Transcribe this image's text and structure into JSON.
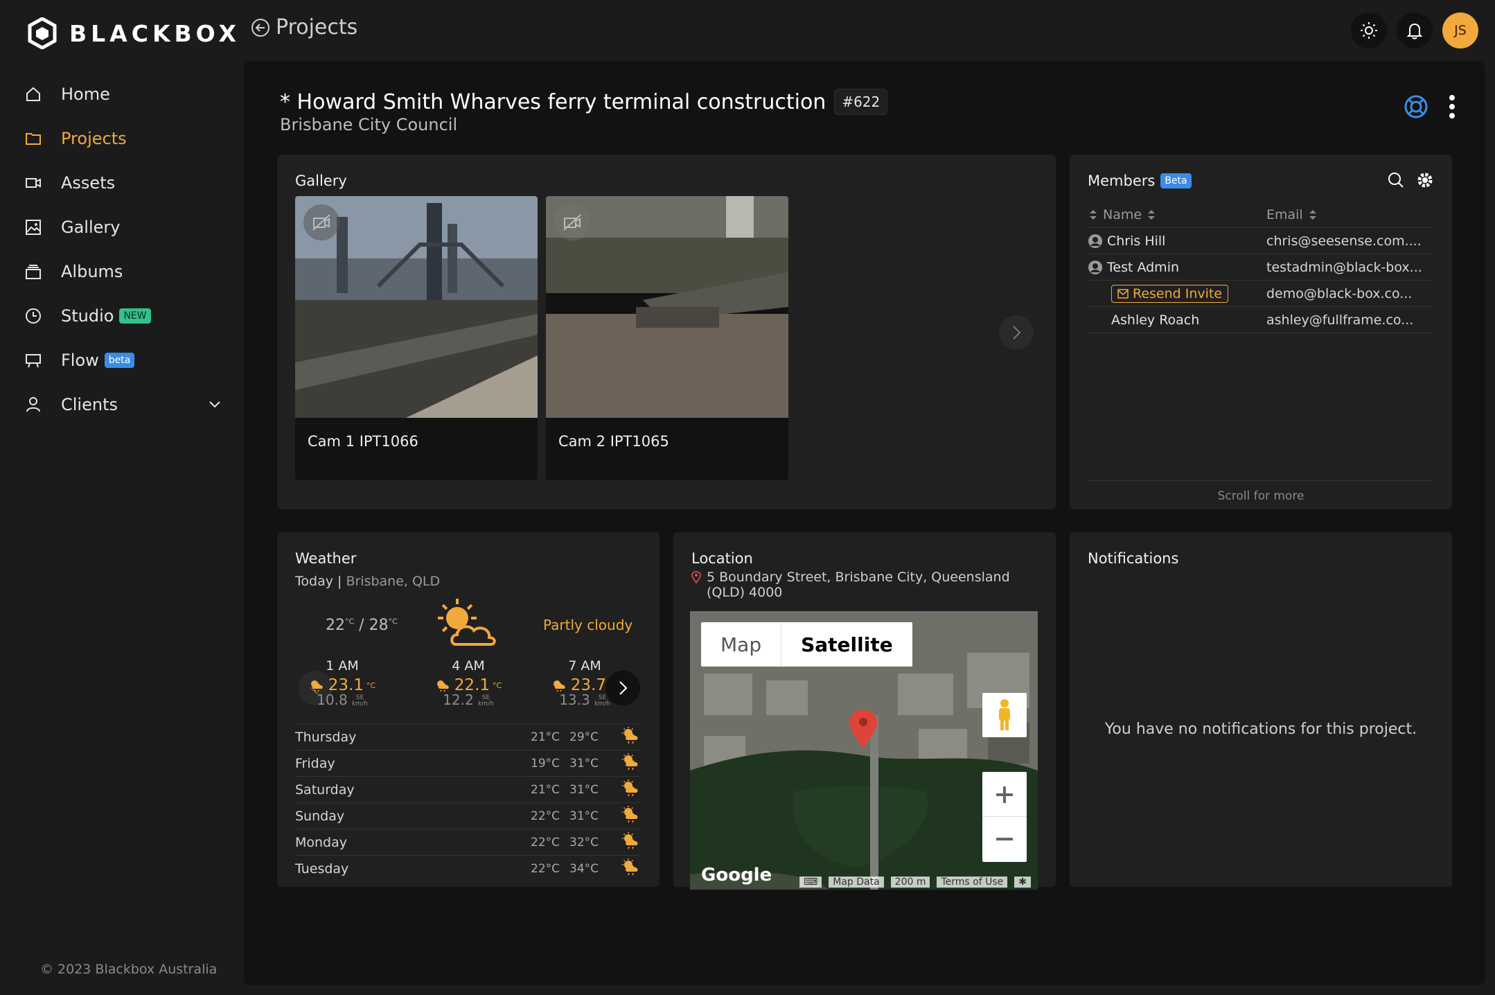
{
  "app": {
    "logo_text": "BLACKBOX",
    "copyright": "© 2023 Blackbox Australia",
    "user_initials": "JS"
  },
  "nav": {
    "items": [
      {
        "label": "Home",
        "icon": "home-icon"
      },
      {
        "label": "Projects",
        "icon": "folder-icon",
        "active": true
      },
      {
        "label": "Assets",
        "icon": "camera-icon"
      },
      {
        "label": "Gallery",
        "icon": "image-icon"
      },
      {
        "label": "Albums",
        "icon": "albums-icon"
      },
      {
        "label": "Studio",
        "icon": "clock-icon",
        "badge": "NEW"
      },
      {
        "label": "Flow",
        "icon": "flow-icon",
        "badge": "beta"
      },
      {
        "label": "Clients",
        "icon": "user-icon",
        "has_dropdown": true
      }
    ]
  },
  "header": {
    "back_label": "Projects"
  },
  "project": {
    "title": "* Howard Smith Wharves ferry terminal construction",
    "id": "#622",
    "client": "Brisbane City Council"
  },
  "gallery": {
    "title": "Gallery",
    "cams": [
      {
        "label": "Cam 1 IPT1066"
      },
      {
        "label": "Cam 2 IPT1065"
      }
    ]
  },
  "members": {
    "title": "Members",
    "badge": "Beta",
    "columns": [
      "Name",
      "Email"
    ],
    "rows": [
      {
        "name": "Chris Hill",
        "email": "chris@seesense.com....",
        "avatar": true
      },
      {
        "name": "Test Admin",
        "email": "testadmin@black-box...",
        "avatar": true
      },
      {
        "name": "Resend Invite",
        "email": "demo@black-box.co...",
        "invite": true
      },
      {
        "name": "Ashley Roach",
        "email": "ashley@fullframe.co..."
      }
    ],
    "scroll_hint": "Scroll for more"
  },
  "weather": {
    "title": "Weather",
    "today": "Today",
    "location": "Brisbane, QLD",
    "temp_low": "22",
    "temp_high": "28",
    "unit": "°C",
    "condition": "Partly cloudy",
    "hourly": [
      {
        "time": "1 AM",
        "temp": "23.1",
        "wind": "10.8",
        "dir": "SE",
        "wind_unit": "km/h"
      },
      {
        "time": "4 AM",
        "temp": "22.1",
        "wind": "12.2",
        "dir": "SE",
        "wind_unit": "km/h"
      },
      {
        "time": "7 AM",
        "temp": "23.7",
        "wind": "13.3",
        "dir": "SE",
        "wind_unit": "km/h"
      }
    ],
    "daily": [
      {
        "day": "Thursday",
        "lo": "21°C",
        "hi": "29°C"
      },
      {
        "day": "Friday",
        "lo": "19°C",
        "hi": "31°C"
      },
      {
        "day": "Saturday",
        "lo": "21°C",
        "hi": "31°C"
      },
      {
        "day": "Sunday",
        "lo": "22°C",
        "hi": "31°C"
      },
      {
        "day": "Monday",
        "lo": "22°C",
        "hi": "32°C"
      },
      {
        "day": "Tuesday",
        "lo": "22°C",
        "hi": "34°C"
      }
    ]
  },
  "location": {
    "title": "Location",
    "address": "5 Boundary Street, Brisbane City, Queensland (QLD) 4000",
    "map_tabs": [
      "Map",
      "Satellite"
    ],
    "map_footer": {
      "data": "Map Data",
      "scale": "200 m",
      "terms": "Terms of Use"
    },
    "google": "Google"
  },
  "notifications": {
    "title": "Notifications",
    "empty": "You have no notifications for this project."
  },
  "colors": {
    "accent": "#f2a93b",
    "background": "#1b1b1c",
    "panel": "#121213",
    "card": "#202021"
  }
}
